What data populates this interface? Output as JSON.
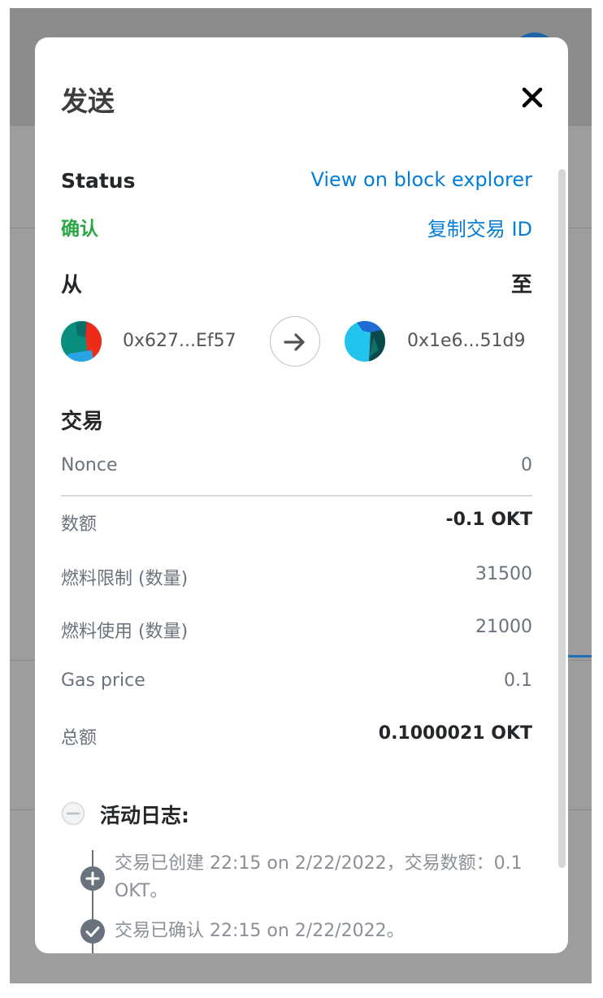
{
  "modal": {
    "title": "发送",
    "close_icon": "close-icon",
    "status": {
      "label": "Status",
      "value": "确认",
      "value_color": "#28a745",
      "explorer_link": "View on block explorer",
      "copy_id": "复制交易 ID"
    },
    "from_label": "从",
    "to_label": "至",
    "from_address": "0x627...Ef57",
    "to_address": "0x1e6...51d9",
    "arrow_icon": "arrow-right-icon",
    "transaction": {
      "heading": "交易",
      "rows": [
        {
          "label": "Nonce",
          "value": "0"
        },
        {
          "label": "数额",
          "value": "-0.1 OKT"
        },
        {
          "label": "燃料限制 (数量)",
          "value": "31500"
        },
        {
          "label": "燃料使用 (数量)",
          "value": "21000"
        },
        {
          "label": "Gas price",
          "value": "0.1"
        },
        {
          "label": "总额",
          "value": "0.1000021 OKT"
        }
      ]
    },
    "activity_log": {
      "title": "活动日志:",
      "toggle_icon": "minus-circle-icon",
      "entries": [
        {
          "icon": "plus-circle-icon",
          "text": "交易已创建 22:15 on 2/22/2022，交易数额：0.1 OKT。"
        },
        {
          "icon": "check-circle-icon",
          "text": "交易已确认 22:15 on 2/22/2022。"
        }
      ]
    }
  },
  "colors": {
    "link": "#037dd6",
    "success": "#28a745",
    "text_dark": "#24272a",
    "text_muted": "#6a737d"
  }
}
